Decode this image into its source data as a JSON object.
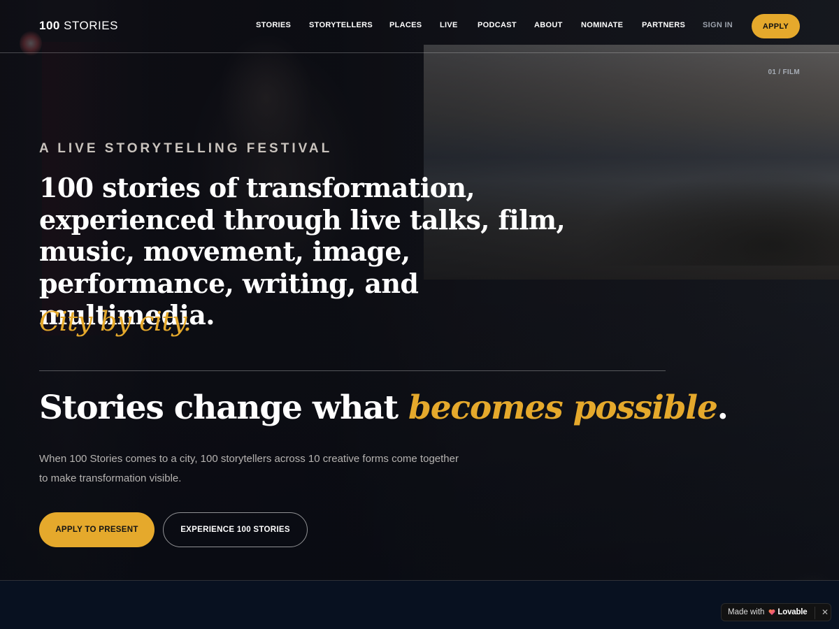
{
  "header": {
    "logo_number": "100",
    "logo_word": "STORIES",
    "nav": [
      "STORIES",
      "STORYTELLERS",
      "PLACES",
      "LIVE",
      "PODCAST",
      "ABOUT",
      "NOMINATE",
      "PARTNERS",
      "SIGN IN"
    ],
    "apply_label": "APPLY"
  },
  "hero": {
    "slide_label": "01 / FILM",
    "eyebrow": "A LIVE STORYTELLING FESTIVAL",
    "headline": "100 stories of transformation, experienced through live talks, film, music, movement, image, performance, writing, and multimedia.",
    "tagline": "City by city.",
    "subhead_prefix": "Stories change what ",
    "subhead_accent": "becomes possible",
    "subhead_suffix": ".",
    "description": "When 100 Stories comes to a city, 100 storytellers across 10 creative forms come together to make transformation visible.",
    "primary_button": "APPLY TO PRESENT",
    "secondary_button": "EXPERIENCE 100 STORIES"
  },
  "badge": {
    "prefix": "Made with",
    "brand": "Lovable",
    "close": "✕"
  },
  "colors": {
    "accent": "#e5a92c",
    "background": "#081120"
  }
}
